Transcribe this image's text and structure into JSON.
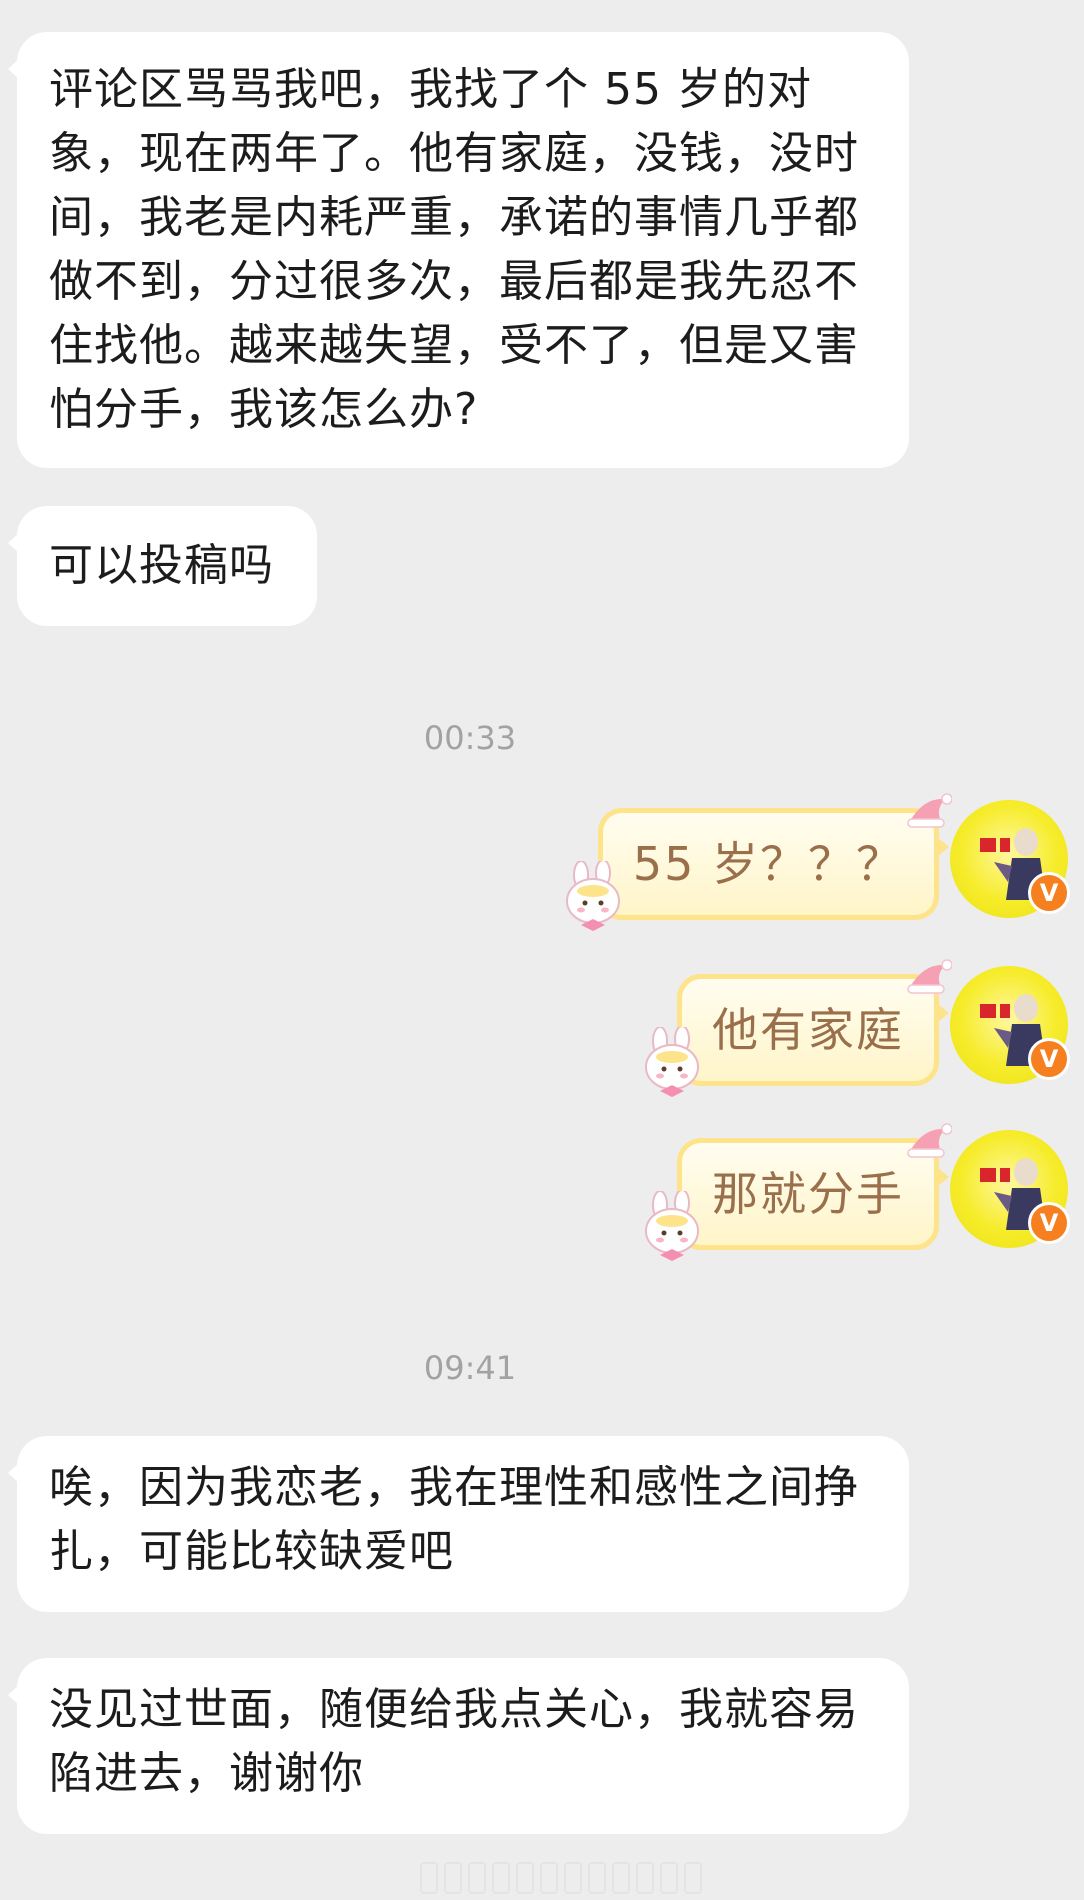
{
  "messages": {
    "in1": "评论区骂骂我吧，我找了个 55 岁的对象，现在两年了。他有家庭，没钱，没时间，我老是内耗严重，承诺的事情几乎都做不到，分过很多次，最后都是我先忍不住找他。越来越失望，受不了，但是又害怕分手，我该怎么办?",
    "in2": "可以投稿吗",
    "time1": "00:33",
    "out1": "55 岁？？？",
    "out2": "他有家庭",
    "out3": "那就分手",
    "time2": "09:41",
    "in3": "唉，因为我恋老，我在理性和感性之间挣扎，可能比较缺爱吧",
    "in4": "没见过世面，随便给我点关心，我就容易陷进去，谢谢你"
  },
  "avatar": {
    "verified_mark": "V"
  },
  "colors": {
    "out_bubble_border": "#fde48a",
    "out_text": "#9a6f4c",
    "avatar_bg": "#f6ec2a",
    "badge": "#f6801f"
  }
}
